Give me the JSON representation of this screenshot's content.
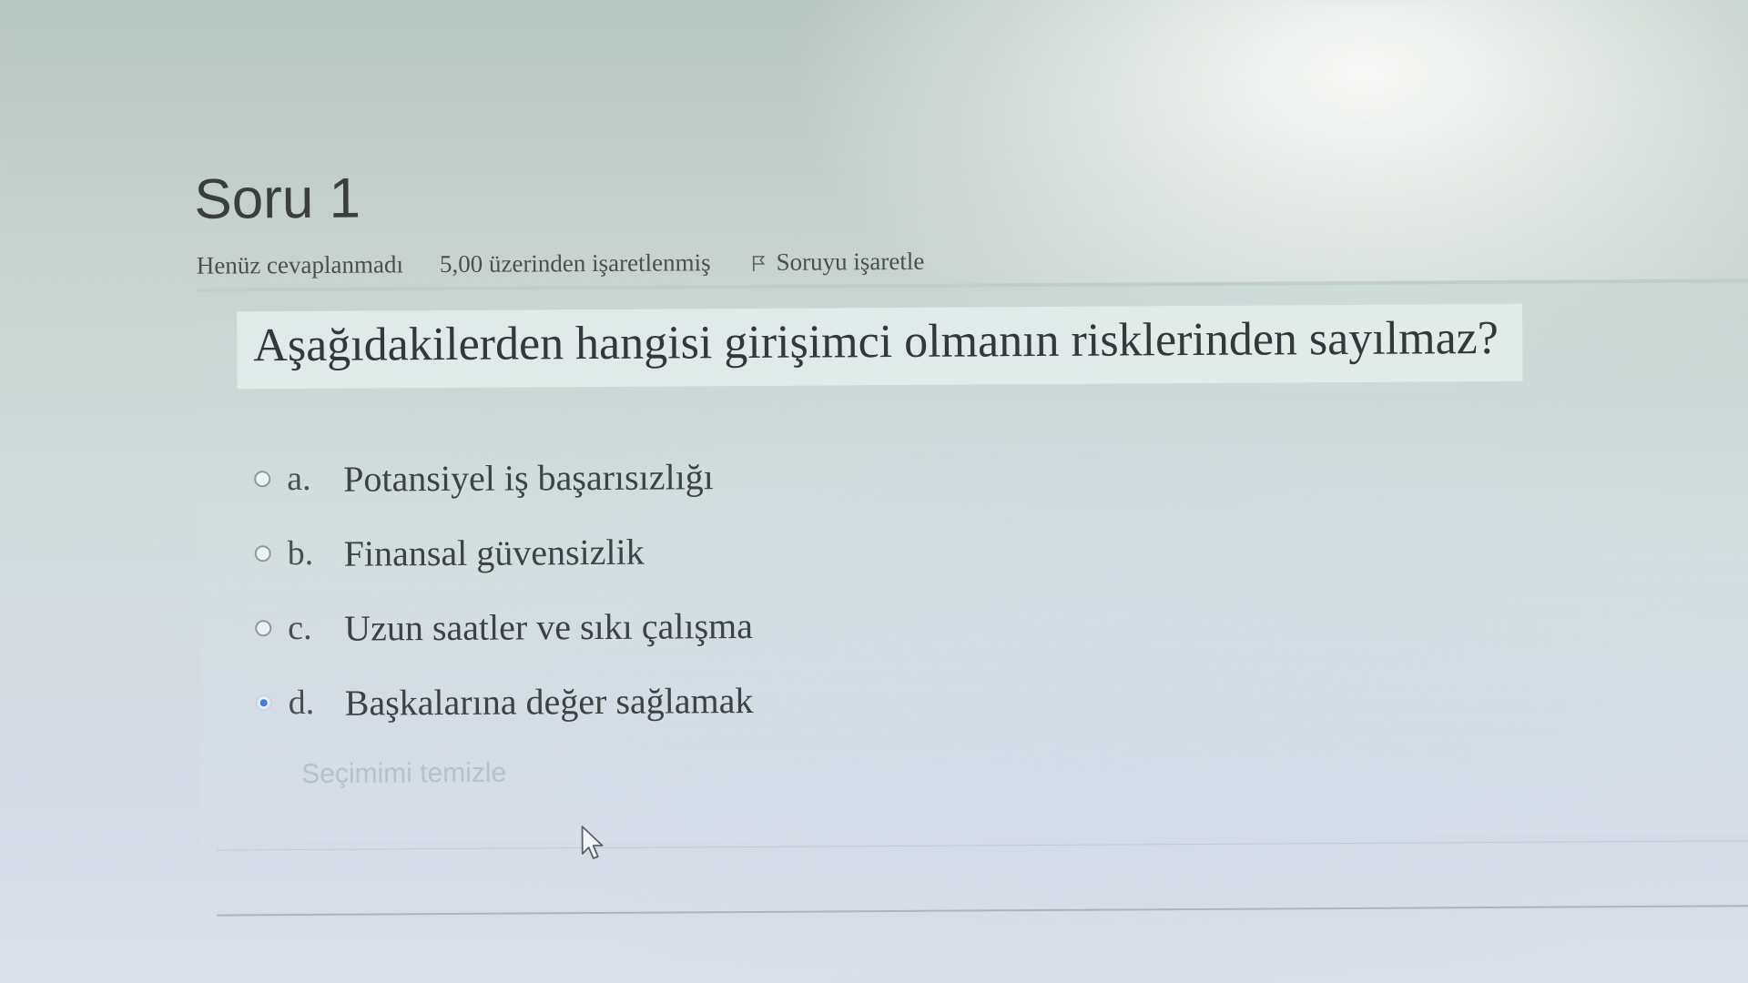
{
  "question": {
    "title": "Soru 1",
    "status": "Henüz cevaplanmadı",
    "marks": "5,00 üzerinden işaretlenmiş",
    "flag_label": "Soruyu işaretle",
    "text": "Aşağıdakilerden hangisi girişimci olmanın risklerinden sayılmaz?"
  },
  "answers": [
    {
      "letter": "a.",
      "text": "Potansiyel iş başarısızlığı",
      "selected": false
    },
    {
      "letter": "b.",
      "text": "Finansal güvensizlik",
      "selected": false
    },
    {
      "letter": "c.",
      "text": "Uzun saatler ve sıkı çalışma",
      "selected": false
    },
    {
      "letter": "d.",
      "text": "Başkalarına değer sağlamak",
      "selected": true
    }
  ],
  "clear_choice_label": "Seçimimi temizle",
  "colors": {
    "radio_selected": "#3f7be0",
    "text_primary": "#33393a",
    "clear_link": "#b5c3cf"
  },
  "icons": {
    "flag": "flag-icon",
    "cursor": "mouse-pointer-icon"
  }
}
